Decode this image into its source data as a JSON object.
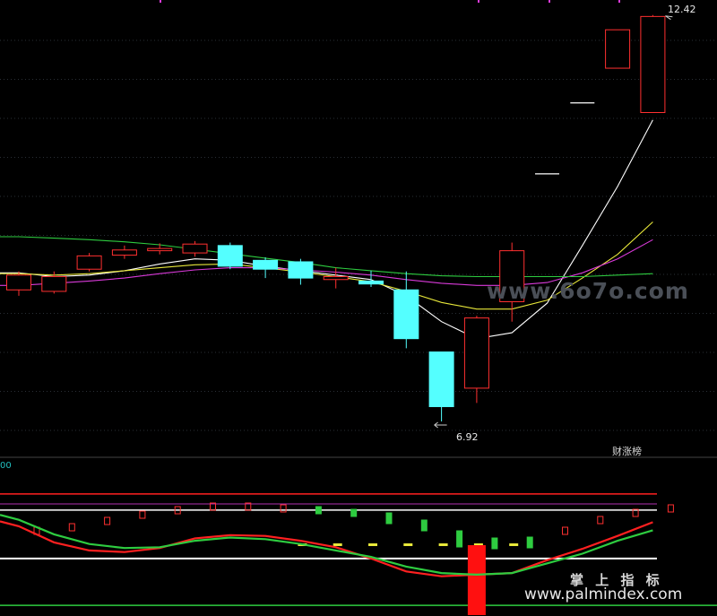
{
  "chart_data": [
    {
      "type": "candlestick",
      "name": "price-panel",
      "candles": [
        {
          "open": 8.7,
          "close": 8.9,
          "high": 8.95,
          "low": 8.62
        },
        {
          "open": 8.68,
          "close": 8.88,
          "high": 8.95,
          "low": 8.65
        },
        {
          "open": 8.98,
          "close": 9.16,
          "high": 9.2,
          "low": 8.95
        },
        {
          "open": 9.17,
          "close": 9.24,
          "high": 9.3,
          "low": 9.12
        },
        {
          "open": 9.23,
          "close": 9.26,
          "high": 9.33,
          "low": 9.18
        },
        {
          "open": 9.2,
          "close": 9.32,
          "high": 9.36,
          "low": 9.15
        },
        {
          "open": 9.3,
          "close": 9.02,
          "high": 9.34,
          "low": 8.98
        },
        {
          "open": 9.1,
          "close": 8.98,
          "high": 9.14,
          "low": 8.86
        },
        {
          "open": 9.08,
          "close": 8.86,
          "high": 9.12,
          "low": 8.77
        },
        {
          "open": 8.84,
          "close": 8.88,
          "high": 9.0,
          "low": 8.72
        },
        {
          "open": 8.82,
          "close": 8.78,
          "high": 8.96,
          "low": 8.74
        },
        {
          "open": 8.7,
          "close": 8.04,
          "high": 8.95,
          "low": 7.91
        },
        {
          "open": 7.86,
          "close": 7.12,
          "high": 7.86,
          "low": 6.92
        },
        {
          "open": 7.37,
          "close": 8.32,
          "high": 8.35,
          "low": 7.17
        },
        {
          "open": 8.54,
          "close": 9.23,
          "high": 9.34,
          "low": 8.27
        },
        {
          "open": 10.27,
          "close": 10.27,
          "high": 10.27,
          "low": 10.27
        },
        {
          "open": 11.23,
          "close": 11.23,
          "high": 11.23,
          "low": 11.23
        },
        {
          "open": 11.7,
          "close": 12.22,
          "high": 12.22,
          "low": 11.7
        },
        {
          "open": 11.1,
          "close": 12.4,
          "high": 12.42,
          "low": 11.1
        }
      ],
      "ma_lines": [
        {
          "color": "#ffffff",
          "values": [
            8.93,
            8.88,
            8.9,
            8.96,
            9.05,
            9.12,
            9.1,
            9.02,
            8.96,
            8.9,
            8.84,
            8.62,
            8.27,
            8.04,
            8.12,
            8.52,
            9.3,
            10.1,
            11.0
          ]
        },
        {
          "color": "#e8e83a",
          "values": [
            8.92,
            8.9,
            8.92,
            8.96,
            9.0,
            9.04,
            9.05,
            9.0,
            8.94,
            8.88,
            8.81,
            8.68,
            8.53,
            8.44,
            8.44,
            8.56,
            8.86,
            9.18,
            9.62
          ]
        },
        {
          "color": "#d93ad9",
          "values": [
            8.76,
            8.79,
            8.82,
            8.86,
            8.92,
            8.97,
            9.0,
            9.0,
            8.97,
            8.94,
            8.9,
            8.84,
            8.79,
            8.76,
            8.76,
            8.8,
            8.93,
            9.12,
            9.38
          ]
        },
        {
          "color": "#2ecc40",
          "values": [
            9.42,
            9.4,
            9.38,
            9.35,
            9.31,
            9.25,
            9.19,
            9.13,
            9.07,
            9.0,
            8.96,
            8.92,
            8.89,
            8.88,
            8.88,
            8.88,
            8.88,
            8.9,
            8.92
          ]
        }
      ],
      "annotations": [
        {
          "text": "12.42",
          "note": "high"
        },
        {
          "text": "6.92",
          "note": "low"
        }
      ],
      "ylim": [
        6.75,
        12.55
      ]
    },
    {
      "type": "line",
      "name": "indicator-panel",
      "panel_label": "00",
      "ylim": [
        -50,
        112
      ],
      "reference_levels": [
        {
          "value": 100,
          "color": "#ff2020"
        },
        {
          "value": 80,
          "color": "#ffffff"
        },
        {
          "value": 20,
          "color": "#ffffff"
        },
        {
          "value": -38,
          "color": "#2ecc40"
        }
      ],
      "series": [
        {
          "color": "#ff2020",
          "values": [
            60,
            40,
            30,
            28,
            33,
            45,
            49,
            48,
            42,
            34,
            20,
            4,
            -2,
            0,
            2,
            18,
            32,
            48,
            65
          ]
        },
        {
          "color": "#2ecc40",
          "values": [
            68,
            50,
            38,
            33,
            34,
            42,
            46,
            44,
            38,
            30,
            22,
            10,
            2,
            0,
            2,
            14,
            26,
            42,
            55
          ]
        }
      ],
      "bars": [
        0,
        0,
        0,
        0,
        0,
        0,
        0,
        0,
        0,
        0,
        0,
        0,
        0,
        -80,
        0,
        0,
        0,
        0,
        0
      ]
    }
  ],
  "watermarks": {
    "site_mid": "www.6o7o.com",
    "brand_cn": "掌 上 指 标",
    "site_bottom": "www.palmindex.com"
  },
  "badge": {
    "text": "财涨榜"
  }
}
